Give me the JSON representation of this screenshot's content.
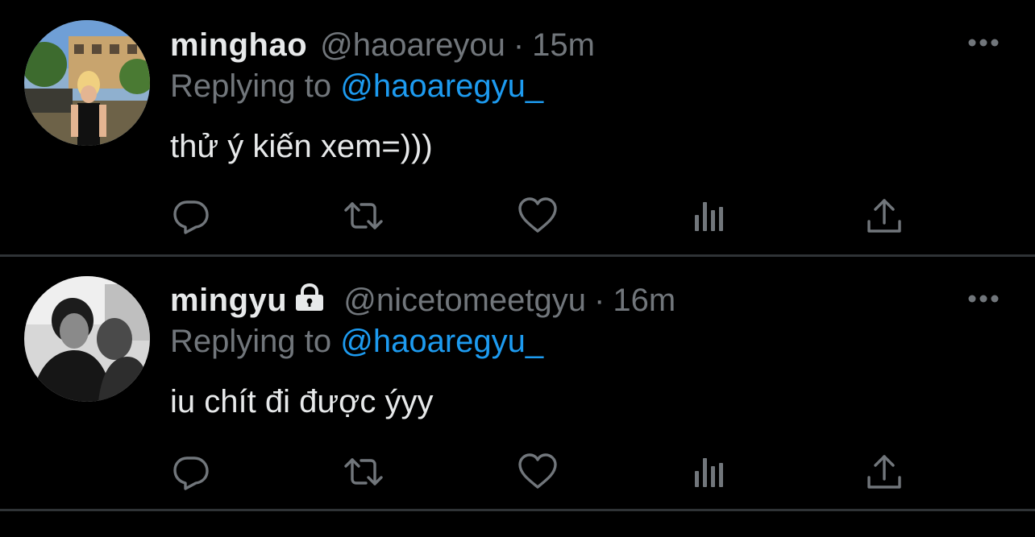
{
  "tweets": [
    {
      "display_name": "minghao",
      "handle": "@haoareyou",
      "separator": "·",
      "time": "15m",
      "replying_prefix": "Replying to",
      "replying_to": "@haoaregyu_",
      "text": "thử ý kiến xem=)))",
      "locked": false,
      "avatar_icon": "avatar-photo-outdoor"
    },
    {
      "display_name": "mingyu",
      "handle": "@nicetomeetgyu",
      "separator": "·",
      "time": "16m",
      "replying_prefix": "Replying to",
      "replying_to": "@haoaregyu_",
      "text": "iu chít đi được ýyy",
      "locked": true,
      "avatar_icon": "avatar-photo-bw"
    }
  ],
  "actions": [
    "reply-icon",
    "retweet-icon",
    "like-icon",
    "analytics-icon",
    "share-icon"
  ],
  "colors": {
    "background": "#000000",
    "primary_text": "#e7e9ea",
    "secondary_text": "#71767b",
    "accent": "#1d9bf0",
    "divider": "#2f3336"
  }
}
